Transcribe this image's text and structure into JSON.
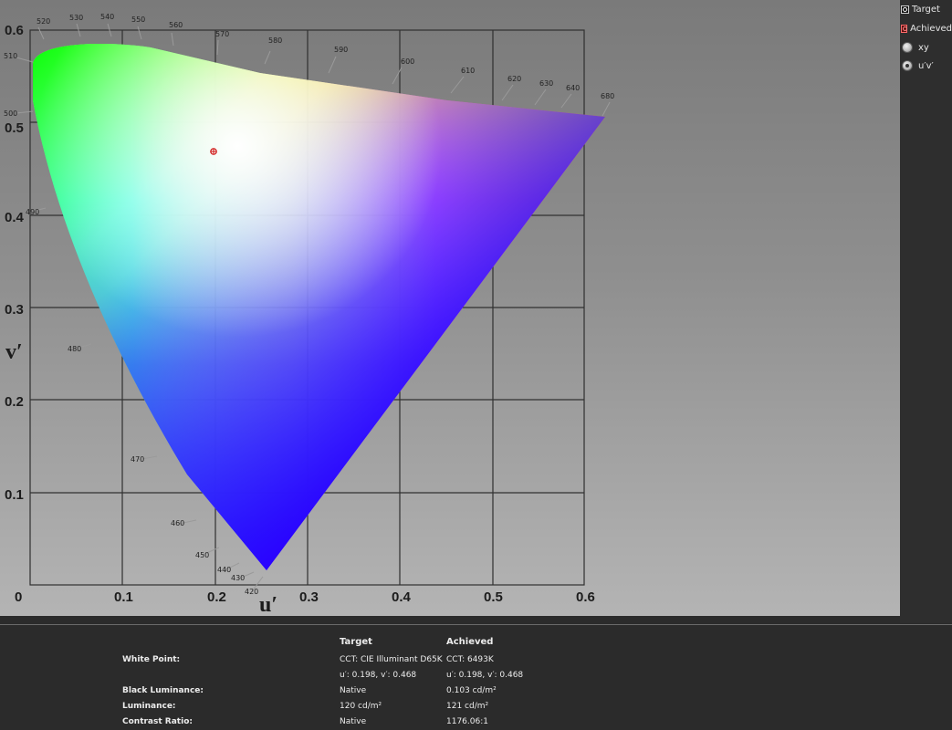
{
  "diagram": {
    "y_ticks": [
      "0.6",
      "0.5",
      "0.4",
      "0.3",
      "0.2",
      "0.1"
    ],
    "x_ticks": [
      "0",
      "0.1",
      "0.2",
      "0.3",
      "0.4",
      "0.5",
      "0.6"
    ],
    "x_axis_title": "u′",
    "y_axis_title": "v′",
    "wavelengths": [
      "520",
      "530",
      "540",
      "550",
      "560",
      "570",
      "580",
      "590",
      "600",
      "610",
      "620",
      "630",
      "640",
      "680",
      "510",
      "500",
      "490",
      "480",
      "470",
      "460",
      "450",
      "440",
      "430",
      "420"
    ]
  },
  "legend": {
    "target": "Target",
    "achieved": "Achieved",
    "options": [
      {
        "label": "xy",
        "selected": false
      },
      {
        "label": "u′v′",
        "selected": true
      }
    ]
  },
  "stats": {
    "headers": {
      "target": "Target",
      "achieved": "Achieved"
    },
    "rows": [
      {
        "label": "White Point:",
        "target": "CCT: CIE Illuminant D65K",
        "achieved": "CCT: 6493K"
      },
      {
        "label": "",
        "target": "u′: 0.198, v′: 0.468",
        "achieved": "u′: 0.198, v′: 0.468"
      },
      {
        "label": "Black Luminance:",
        "target": "Native",
        "achieved": "0.103 cd/m²"
      },
      {
        "label": "Luminance:",
        "target": "120 cd/m²",
        "achieved": "121 cd/m²"
      },
      {
        "label": "Contrast Ratio:",
        "target": "Native",
        "achieved": "1176.06:1"
      }
    ]
  }
}
